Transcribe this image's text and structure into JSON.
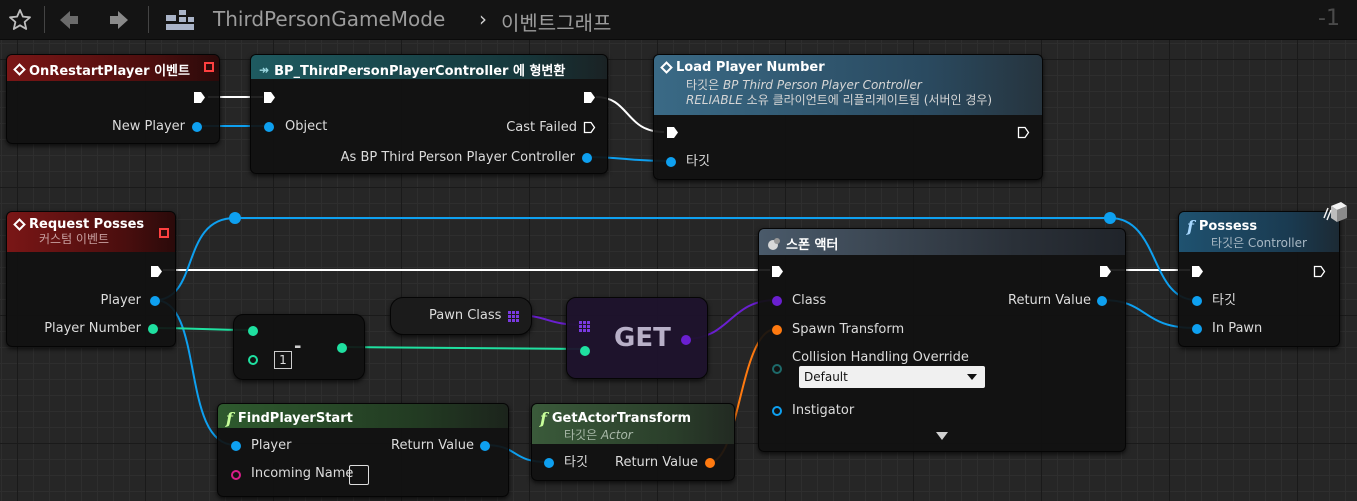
{
  "toolbar": {
    "breadcrumb_parent": "ThirdPersonGameMode",
    "breadcrumb_separator": "›",
    "breadcrumb_current": "이벤트그래프",
    "zoom": "-1"
  },
  "nodes": {
    "on_restart": {
      "title": "OnRestartPlayer 이벤트",
      "pin_new_player": "New Player"
    },
    "cast": {
      "title": "BP_ThirdPersonPlayerController 에 형변환",
      "pin_object": "Object",
      "pin_cast_failed": "Cast Failed",
      "pin_as": "As BP Third Person Player Controller"
    },
    "load_player": {
      "title": "Load Player Number",
      "target_prefix": "타깃은 ",
      "target_class": "BP Third Person Player Controller",
      "replication_keyword": "RELIABLE",
      "replication_note": " 소유 클라이언트에 리플리케이트됨 (서버인 경우)",
      "pin_target": "타깃"
    },
    "request_possess": {
      "title": "Request Posses",
      "subtitle": "커스텀 이벤트",
      "pin_player": "Player",
      "pin_player_number": "Player Number"
    },
    "subtract": {
      "symbol": "-",
      "value": "1"
    },
    "pawn_class": {
      "label": "Pawn Class"
    },
    "get": {
      "label": "GET"
    },
    "spawn": {
      "title": "스폰 액터",
      "pin_class": "Class",
      "pin_spawn_transform": "Spawn Transform",
      "pin_collision": "Collision Handling Override",
      "collision_value": "Default",
      "pin_instigator": "Instigator",
      "pin_return": "Return Value"
    },
    "possess": {
      "title": "Possess",
      "subtitle": "타깃은 Controller",
      "pin_target": "타깃",
      "pin_in_pawn": "In Pawn"
    },
    "find_start": {
      "title": "FindPlayerStart",
      "pin_player": "Player",
      "pin_incoming": "Incoming Name",
      "pin_return": "Return Value"
    },
    "get_transform": {
      "title": "GetActorTransform",
      "subtitle_prefix": "타깃은 ",
      "subtitle_class": "Actor",
      "pin_target": "타깃",
      "pin_return": "Return Value"
    }
  },
  "colors": {
    "exec": "#ffffff",
    "object_pin": "#0ea0f0",
    "integer_pin": "#1fe0a0",
    "class_pin": "#6a1fd0",
    "struct_pin": "#ff7a10",
    "event_header": "#7a1616",
    "cast_header": "#1e5a60",
    "function_header": "#1f5270",
    "pure_header": "#2c4a2c"
  },
  "icons": [
    "star-icon",
    "back-arrow-icon",
    "forward-arrow-icon",
    "blueprint-graph-icon",
    "event-diamond-icon",
    "function-icon",
    "spawn-actor-icon",
    "cube-icon"
  ]
}
